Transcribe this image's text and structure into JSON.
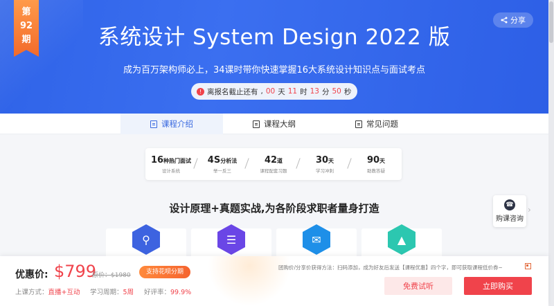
{
  "hero": {
    "badge": {
      "line1": "第",
      "line2": "92",
      "line3": "期"
    },
    "title": "系统设计 System Design 2022 版",
    "subtitle": "成为百万架构师必上，34课时带你快速掌握16大系统设计知识点与面试考点",
    "share_label": "分享",
    "countdown": {
      "prefix": "离报名截止还有",
      "days": "00",
      "days_unit": "天",
      "hours": "11",
      "hours_unit": "时",
      "minutes": "13",
      "minutes_unit": "分",
      "seconds": "50",
      "seconds_unit": "秒"
    }
  },
  "tabs": [
    {
      "label": "课程介绍",
      "active": true
    },
    {
      "label": "课程大纲",
      "active": false
    },
    {
      "label": "常见问题",
      "active": false
    }
  ],
  "stats": [
    {
      "num": "16",
      "unit": "种热门面试",
      "caption": "设计系统"
    },
    {
      "num": "4S",
      "unit": "分析法",
      "caption": "举一反三"
    },
    {
      "num": "42",
      "unit": "道",
      "caption": "课程配套习题"
    },
    {
      "num": "30",
      "unit": "天",
      "caption": "学习冲刺"
    },
    {
      "num": "90",
      "unit": "天",
      "caption": "助教答疑"
    }
  ],
  "section_title": "设计原理+真题实战,为各阶段求职者量身打造",
  "features": [
    {
      "icon": "person-search-icon",
      "color": "#3d63e0"
    },
    {
      "icon": "layers-icon",
      "color": "#6a46e6"
    },
    {
      "icon": "inbox-icon",
      "color": "#1e8fe8"
    },
    {
      "icon": "chart-icon",
      "color": "#2cc7b0"
    }
  ],
  "consult_label": "购课咨询",
  "bottom": {
    "price_label": "优惠价:",
    "price": "$799",
    "original_price": "原价：$1980",
    "installment": "支持花呗分期",
    "method_label": "上课方式：",
    "method_value": "直播+互动",
    "period_label": "学习周期：",
    "period_value": "5周",
    "rating_label": "好评率：",
    "rating_value": "99.9%",
    "promo": "团购价/分享价获得方法：扫码添加，成为好友后发送【课程优惠】四个字，即可获取课程低价券~",
    "trial_button": "免费试听",
    "buy_button": "立即购买"
  }
}
